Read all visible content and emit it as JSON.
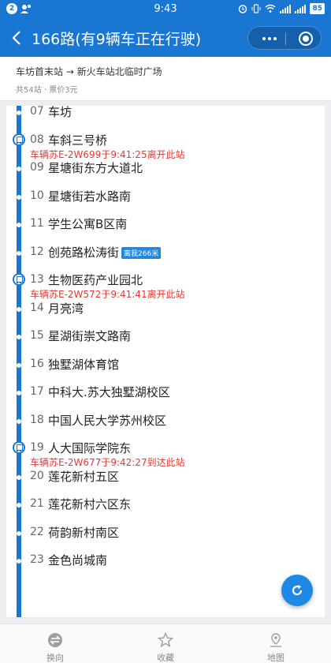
{
  "status": {
    "notif_count": "2",
    "time": "9:43",
    "battery": "85"
  },
  "header": {
    "title": "166路(有9辆车正在行驶)"
  },
  "route": {
    "from_to": "车坊首末站 → 新火车站北临时广场",
    "meta": "共54站 · 票价3元"
  },
  "stops": [
    {
      "num": "07",
      "name": "车坊",
      "bus": ""
    },
    {
      "num": "08",
      "name": "车斜三号桥",
      "bus": "车辆苏E-2W699于9:41:25离开此站"
    },
    {
      "num": "09",
      "name": "星塘街东方大道北",
      "bus": ""
    },
    {
      "num": "10",
      "name": "星塘街若水路南",
      "bus": ""
    },
    {
      "num": "11",
      "name": "学生公寓B区南",
      "bus": ""
    },
    {
      "num": "12",
      "name": "创苑路松涛街",
      "bus": "",
      "tag": "离我266米"
    },
    {
      "num": "13",
      "name": "生物医药产业园北",
      "bus": "车辆苏E-2W572于9:41:41离开此站"
    },
    {
      "num": "14",
      "name": "月亮湾",
      "bus": ""
    },
    {
      "num": "15",
      "name": "星湖街崇文路南",
      "bus": ""
    },
    {
      "num": "16",
      "name": "独墅湖体育馆",
      "bus": ""
    },
    {
      "num": "17",
      "name": "中科大.苏大独墅湖校区",
      "bus": ""
    },
    {
      "num": "18",
      "name": "中国人民大学苏州校区",
      "bus": ""
    },
    {
      "num": "19",
      "name": "人大国际学院东",
      "bus": "车辆苏E-2W677于9:42:27到达此站"
    },
    {
      "num": "20",
      "name": "莲花新村五区",
      "bus": ""
    },
    {
      "num": "21",
      "name": "莲花新村六区东",
      "bus": ""
    },
    {
      "num": "22",
      "name": "荷韵新村南区",
      "bus": ""
    },
    {
      "num": "23",
      "name": "金色尚城南",
      "bus": ""
    }
  ],
  "nav": {
    "switch": "换向",
    "favorite": "收藏",
    "map": "地图"
  },
  "icons": [
    "back-icon",
    "more-icon",
    "target-icon",
    "bus-icon",
    "refresh-icon",
    "switch-icon",
    "star-icon",
    "map-pin-icon"
  ],
  "colors": {
    "primary": "#1976d2",
    "alert": "#e53935"
  }
}
